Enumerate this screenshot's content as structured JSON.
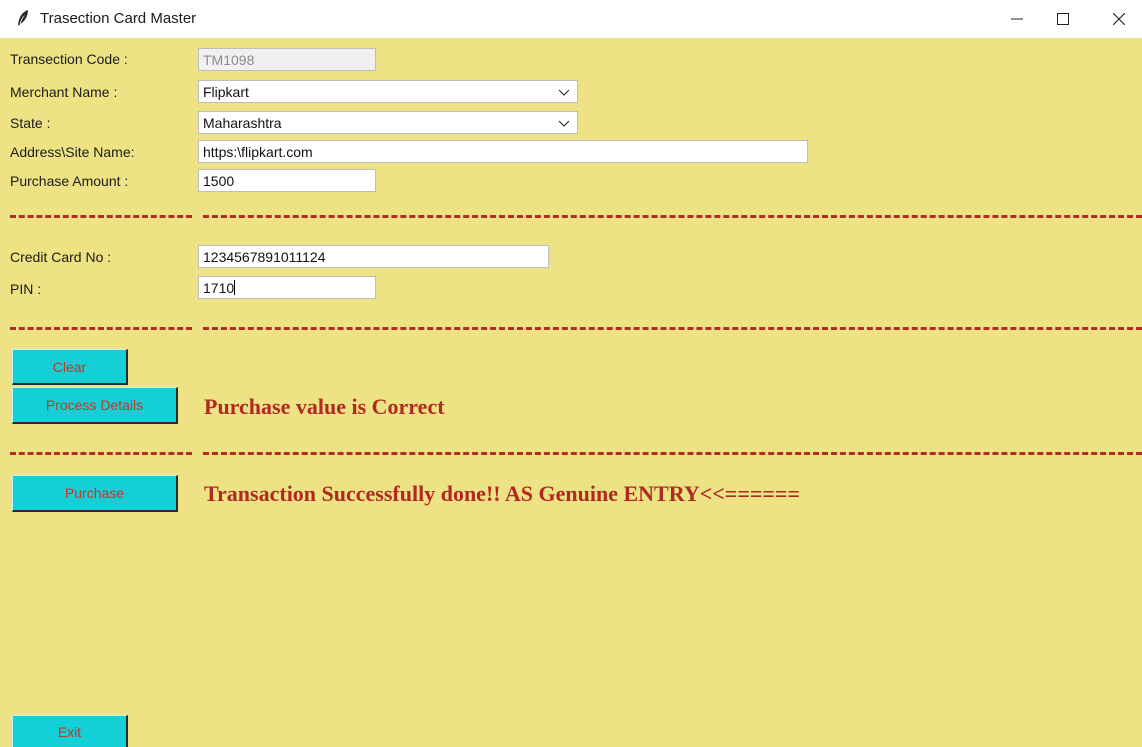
{
  "window": {
    "title": "Trasection Card Master"
  },
  "form": {
    "transaction_code": {
      "label": "Transection Code :",
      "value": "TM1098"
    },
    "merchant_name": {
      "label": "Merchant Name :",
      "value": "Flipkart"
    },
    "state": {
      "label": "State :",
      "value": "Maharashtra"
    },
    "address": {
      "label": "Address\\Site Name:",
      "value": "https:\\flipkart.com"
    },
    "purchase_amount": {
      "label": "Purchase Amount :",
      "value": "1500"
    },
    "credit_card_no": {
      "label": "Credit Card No :",
      "value": "1234567891011124"
    },
    "pin": {
      "label": "PIN :",
      "value": "1710"
    }
  },
  "buttons": {
    "clear": "Clear",
    "process_details": "Process Details",
    "purchase": "Purchase",
    "exit": "Exit"
  },
  "messages": {
    "process_result": "Purchase value is Correct",
    "purchase_result": "Transaction Successfully done!! AS Genuine ENTRY<<======"
  },
  "colors": {
    "background": "#ede384",
    "button": "#14cfd6",
    "accent_red": "#b02a23"
  },
  "icons": {
    "app": "feather-icon",
    "minimize": "minimize-icon",
    "maximize": "maximize-icon",
    "close": "close-icon",
    "dropdown": "chevron-down-icon"
  }
}
